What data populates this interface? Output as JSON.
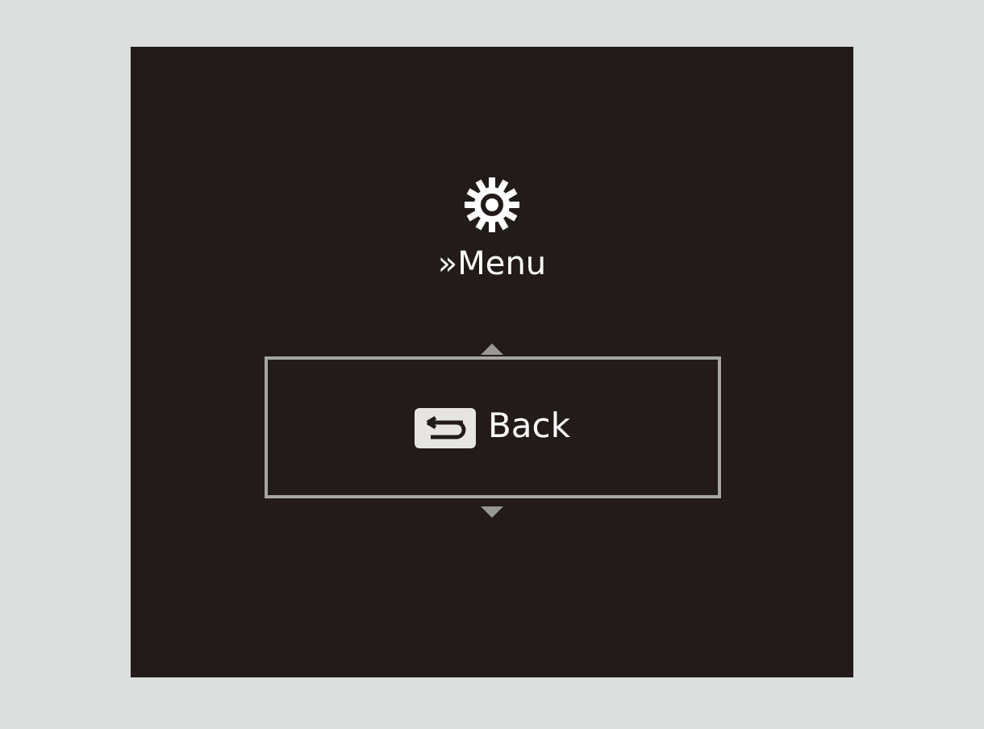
{
  "header": {
    "title": "»Menu"
  },
  "menu": {
    "items": [
      {
        "label": "Back",
        "selected": true
      }
    ]
  }
}
